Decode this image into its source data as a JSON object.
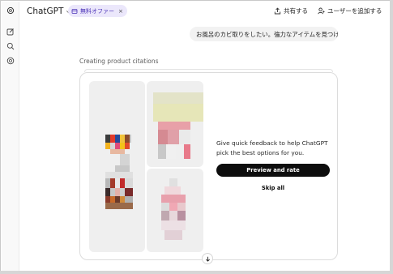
{
  "header": {
    "model_name": "ChatGPT",
    "offer_chip_label": "無料オファー",
    "offer_chip_close": "×",
    "share_label": "共有する",
    "add_user_label": "ユーザーを追加する",
    "more_label": "⋮"
  },
  "conversation": {
    "user_message": "お風呂のカビ取りをしたい。強力なアイテムを見つけて。",
    "status_label": "Creating product citations"
  },
  "feedback_card": {
    "prompt_text": "Give quick feedback to help ChatGPT pick the best options for you.",
    "preview_button_label": "Preview and rate",
    "skip_button_label": "Skip all"
  },
  "colors": {
    "accent_chip_bg": "#ebe7fb",
    "accent_chip_text": "#4b32b8",
    "primary_button_bg": "#0d0d0d",
    "user_bubble_bg": "#f2f2f2"
  },
  "icons": {
    "rail": [
      "chatgpt-logo-icon",
      "new-chat-icon",
      "search-icon",
      "explore-gpts-icon"
    ],
    "header": [
      "chevron-down-icon",
      "offer-chip-icon",
      "share-icon",
      "add-user-icon",
      "more-options-icon"
    ],
    "card": [
      "scroll-down-arrow-icon"
    ]
  }
}
